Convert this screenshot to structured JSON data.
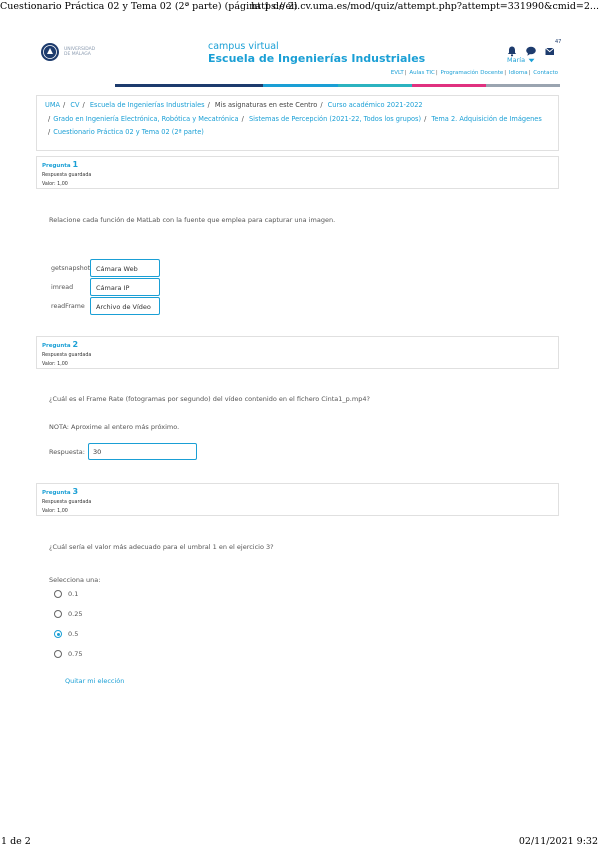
{
  "print": {
    "page_title": "Cuestionario Práctica 02 y Tema 02 (2ª parte) (página 1 de 2)",
    "url": "https://eii.cv.uma.es/mod/quiz/attempt.php?attempt=331990&cmid=2...",
    "page_num": "1 de 2",
    "datetime": "02/11/2021 9:32"
  },
  "header": {
    "logo_text_line1": "UNIVERSIDAD",
    "logo_text_line2": "DE MÁLAGA",
    "brand_sub": "campus virtual",
    "brand_main": "Escuela de Ingenierías Industriales",
    "message_count": "47",
    "user_name": "María",
    "colors": {
      "brand": "#1a9fd5",
      "navy": "#1d3b6d",
      "pink": "#e0317f",
      "teal": "#2bb3c0"
    },
    "top_links": [
      "EVLT",
      "Aulas TIC",
      "Programación Docente",
      "Idioma",
      "Contacto"
    ]
  },
  "breadcrumb": {
    "items": [
      "UMA",
      "CV",
      "Escuela de Ingenierías Industriales",
      "Mis asignaturas en este Centro",
      "Curso académico 2021-2022",
      "Grado en Ingeniería Electrónica, Robótica y Mecatrónica",
      "Sistemas de Percepción (2021-22, Todos los grupos)",
      "Tema 2. Adquisición de Imágenes",
      "Cuestionario Práctica 02 y Tema 02 (2ª parte)"
    ]
  },
  "questions": [
    {
      "label": "Pregunta",
      "number": "1",
      "status": "Respuesta guardada",
      "value": "Valor: 1,00",
      "text": "Relacione cada función de MatLab con la fuente que emplea para capturar una imagen.",
      "pairs": [
        {
          "function": "getsnapshot",
          "answer": "Cámara Web"
        },
        {
          "function": "imread",
          "answer": "Cámara IP"
        },
        {
          "function": "readFrame",
          "answer": "Archivo de Vídeo"
        }
      ]
    },
    {
      "label": "Pregunta",
      "number": "2",
      "status": "Respuesta guardada",
      "value": "Valor: 1,00",
      "text": "¿Cuál es el Frame Rate (fotogramas por segundo) del vídeo contenido en el fichero Cinta1_p.mp4?",
      "note": "NOTA: Aproxime al entero más próximo.",
      "answer_label": "Respuesta:",
      "answer_value": "30"
    },
    {
      "label": "Pregunta",
      "number": "3",
      "status": "Respuesta guardada",
      "value": "Valor: 1,00",
      "text": "¿Cuál sería el valor más adecuado para el umbral 1 en el ejercicio 3?",
      "prompt": "Selecciona una:",
      "options": [
        "0.1",
        "0.25",
        "0.5",
        "0.75"
      ],
      "selected": "0.5",
      "clear_label": "Quitar mi elección"
    }
  ]
}
